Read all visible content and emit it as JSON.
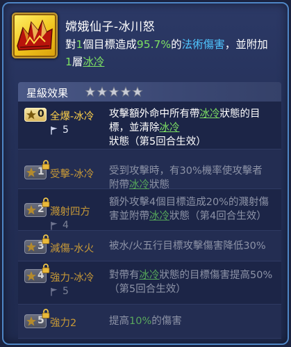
{
  "skill": {
    "name": "嫦娥仙子-冰川怒",
    "icon": "ice-crystal-icon",
    "desc_prefix": "對",
    "desc_targets": "1",
    "desc_mid": "個目標造成",
    "desc_percent": "95.7%",
    "desc_of": "的",
    "desc_damage_type": "法術傷害",
    "desc_suffix": "，並附加",
    "desc_layers": "1",
    "desc_layer_text": "層",
    "desc_status": "冰冷"
  },
  "star_section": {
    "title": "星級效果",
    "star_count": 5
  },
  "rows": [
    {
      "level": "0",
      "name": "全爆-冰冷",
      "locked": false,
      "flag": "5",
      "desc_parts": [
        {
          "text": "攻擊額外命中所有帶"
        },
        {
          "text": "冰冷",
          "ice": true
        },
        {
          "text": "狀態的目標，並清除"
        },
        {
          "text": "冰冷",
          "ice": true
        },
        {
          "text": "狀態（第5回合生效）"
        }
      ]
    },
    {
      "level": "1",
      "name": "受擊-冰冷",
      "locked": true,
      "flag": "",
      "desc_parts": [
        {
          "text": "受到攻擊時，有30%機率使攻擊者附帶"
        },
        {
          "text": "冰冷",
          "ice": true
        },
        {
          "text": "狀態"
        }
      ]
    },
    {
      "level": "2",
      "name": "濺射四方",
      "locked": true,
      "flag": "4",
      "desc_parts": [
        {
          "text": "額外攻擊4個目標造成20%的濺射傷害並附帶"
        },
        {
          "text": "冰冷",
          "ice": true
        },
        {
          "text": "狀態（第4回合生效）"
        }
      ]
    },
    {
      "level": "3",
      "name": "減傷-水火",
      "locked": true,
      "flag": "",
      "desc_parts": [
        {
          "text": "被水/火五行目標攻擊傷害降低30%"
        }
      ]
    },
    {
      "level": "4",
      "name": "強力-冰冷",
      "locked": true,
      "flag": "5",
      "desc_parts": [
        {
          "text": "對帶有"
        },
        {
          "text": "冰冷",
          "ice": true
        },
        {
          "text": "狀態的目標傷害提高50%（第5回合生效）"
        }
      ]
    },
    {
      "level": "5",
      "name": "強力2",
      "locked": true,
      "flag": "",
      "desc_parts": [
        {
          "text": "提高"
        },
        {
          "text": "10%",
          "green": true
        },
        {
          "text": "的傷害"
        }
      ]
    }
  ],
  "icons": {
    "star": "star-icon",
    "lock": "lock-icon",
    "flag": "flag-icon"
  },
  "colors": {
    "accent_green": "#7de063",
    "accent_blue": "#4fc6ff",
    "gold": "#ffd24a",
    "locked_gold": "#c79937"
  }
}
